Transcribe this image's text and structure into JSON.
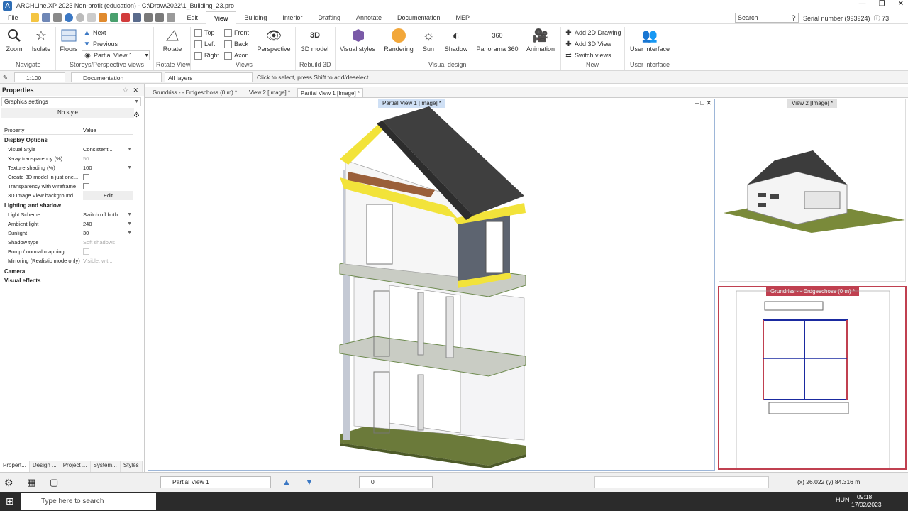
{
  "window": {
    "title": "ARCHLine.XP 2023 Non-profit (education) - C:\\Draw\\2022\\1_Building_23.pro",
    "controls": [
      "—",
      "❒",
      "✕"
    ]
  },
  "menu": {
    "items": [
      "File",
      "Edit",
      "View",
      "Building",
      "Interior",
      "Drafting",
      "Annotate",
      "Documentation",
      "MEP"
    ],
    "active": "View",
    "search_placeholder": "Search",
    "serial": "Serial number (993924)",
    "count": "73"
  },
  "ribbon": {
    "navigate": {
      "zoom": "Zoom",
      "isolate": "Isolate",
      "group": "Navigate"
    },
    "storeys": {
      "floors": "Floors",
      "next": "Next",
      "previous": "Previous",
      "partial": "Partial View 1",
      "group": "Storeys/Perspective views"
    },
    "rotate": {
      "label": "Rotate",
      "group": "Rotate View"
    },
    "views": {
      "top": "Top",
      "left": "Left",
      "right": "Right",
      "front": "Front",
      "back": "Back",
      "axon": "Axon",
      "perspective": "Perspective",
      "group": "Views"
    },
    "rebuild": {
      "label": "3D model",
      "group": "Rebuild 3D"
    },
    "visual": {
      "styles": "Visual styles",
      "rendering": "Rendering",
      "sun": "Sun",
      "shadow": "Shadow",
      "panorama": "Panorama 360",
      "animation": "Animation",
      "group": "Visual design"
    },
    "new": {
      "add2d": "Add 2D Drawing",
      "add3d": "Add 3D View",
      "switch": "Switch views",
      "group": "New"
    },
    "ui": {
      "label": "User interface",
      "group": "User interface"
    }
  },
  "toolrow": {
    "scale": "1:100",
    "documentation": "Documentation",
    "layers": "All layers",
    "hint": "Click to select, press Shift to add/deselect"
  },
  "properties": {
    "title": "Properties",
    "category": "Graphics settings",
    "style": "No style",
    "col_property": "Property",
    "col_value": "Value",
    "sections": {
      "display": "Display Options",
      "lighting": "Lighting and shadow",
      "camera": "Camera",
      "effects": "Visual effects"
    },
    "rows": [
      {
        "k": "Visual Style",
        "v": "Consistent..."
      },
      {
        "k": "X-ray transparency (%)",
        "v": "50"
      },
      {
        "k": "Texture shading (%)",
        "v": "100"
      },
      {
        "k": "Create 3D model in just one...",
        "v": ""
      },
      {
        "k": "Transparency with wireframe",
        "v": ""
      },
      {
        "k": "3D Image View background ...",
        "v": "Edit"
      },
      {
        "k": "Light Scheme",
        "v": "Switch off both"
      },
      {
        "k": "Ambient light",
        "v": "240"
      },
      {
        "k": "Sunlight",
        "v": "30"
      },
      {
        "k": "Shadow type",
        "v": "Soft shadows"
      },
      {
        "k": "Bump / normal mapping",
        "v": ""
      },
      {
        "k": "Mirroring (Realistic mode only)",
        "v": "Visible, wit..."
      }
    ],
    "bottom_tabs": [
      "Propert...",
      "Design ...",
      "Project ...",
      "System...",
      "Styles"
    ]
  },
  "doc_tabs": [
    "Grundriss -  - Erdgeschoss (0 m) *",
    "View 2 [Image] *",
    "Partial View 1 [Image] *"
  ],
  "viewports": {
    "main_title": "Partial View 1 [Image] *",
    "view2_title": "View 2 [Image] *",
    "plan_title": "Grundriss -  - Erdgeschoss (0 m) *"
  },
  "statusbar": {
    "view": "Partial View 1",
    "layer_value": "0",
    "coords": "(x) 26.022  (y) 84.316 m"
  },
  "taskbar": {
    "search": "Type here to search",
    "lang": "HUN",
    "time": "09:18",
    "date": "17/02/2023"
  }
}
